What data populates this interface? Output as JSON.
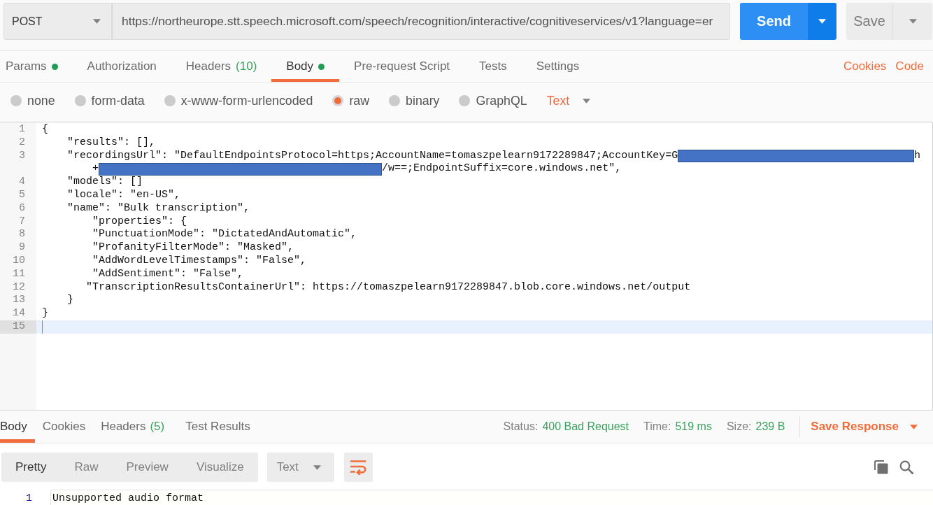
{
  "request_bar": {
    "method": "POST",
    "url": "https://northeurope.stt.speech.microsoft.com/speech/recognition/interactive/cognitiveservices/v1?language=er",
    "send": "Send",
    "save": "Save"
  },
  "request_tabs": [
    {
      "label": "Params",
      "dot": true,
      "selected": false
    },
    {
      "label": "Authorization",
      "dot": false,
      "selected": false
    },
    {
      "label": "Headers",
      "count": "(10)",
      "dot": false,
      "selected": false
    },
    {
      "label": "Body",
      "dot": true,
      "selected": true
    },
    {
      "label": "Pre-request Script",
      "dot": false,
      "selected": false
    },
    {
      "label": "Tests",
      "dot": false,
      "selected": false
    },
    {
      "label": "Settings",
      "dot": false,
      "selected": false
    }
  ],
  "request_links": [
    "Cookies",
    "Code"
  ],
  "body_types": [
    {
      "label": "none",
      "selected": false
    },
    {
      "label": "form-data",
      "selected": false
    },
    {
      "label": "x-www-form-urlencoded",
      "selected": false
    },
    {
      "label": "raw",
      "selected": true
    },
    {
      "label": "binary",
      "selected": false
    },
    {
      "label": "GraphQL",
      "selected": false
    }
  ],
  "body_format": "Text",
  "editor": {
    "lines": [
      {
        "number": "1",
        "kind": "plain",
        "text": "{",
        "current": false
      },
      {
        "number": "2",
        "kind": "plain",
        "text": "    \"results\": [],",
        "current": false
      },
      {
        "number": "3",
        "kind": "wrapped",
        "current": false,
        "rows": [
          {
            "parts": [
              {
                "kind": "text",
                "text": "    \"recordingsUrl\": \"DefaultEndpointsProtocol=https;AccountName=tomaszpelearn9172289847;AccountKey=G"
              },
              {
                "kind": "redacted"
              },
              {
                "kind": "text",
                "text": "h"
              }
            ]
          },
          {
            "parts": [
              {
                "kind": "text",
                "text": "+"
              },
              {
                "kind": "redacted"
              },
              {
                "kind": "text",
                "text": "/w==;EndpointSuffix=core.windows.net\","
              }
            ]
          }
        ]
      },
      {
        "number": "4",
        "kind": "plain",
        "text": "    \"models\": []",
        "current": false
      },
      {
        "number": "5",
        "kind": "plain",
        "text": "    \"locale\": \"en-US\",",
        "current": false
      },
      {
        "number": "6",
        "kind": "plain",
        "text": "    \"name\": \"Bulk transcription\",",
        "current": false
      },
      {
        "number": "7",
        "kind": "plain",
        "text": "        \"properties\": {",
        "current": false
      },
      {
        "number": "8",
        "kind": "plain",
        "text": "        \"PunctuationMode\": \"DictatedAndAutomatic\",",
        "current": false
      },
      {
        "number": "9",
        "kind": "plain",
        "text": "        \"ProfanityFilterMode\": \"Masked\",",
        "current": false
      },
      {
        "number": "10",
        "kind": "plain",
        "text": "        \"AddWordLevelTimestamps\": \"False\",",
        "current": false
      },
      {
        "number": "11",
        "kind": "plain",
        "text": "        \"AddSentiment\": \"False\",",
        "current": false
      },
      {
        "number": "12",
        "kind": "plain",
        "text": "       \"TranscriptionResultsContainerUrl\": https://tomaszpelearn9172289847.blob.core.windows.net/output",
        "current": false
      },
      {
        "number": "13",
        "kind": "plain",
        "text": "    }",
        "current": false
      },
      {
        "number": "14",
        "kind": "plain",
        "text": "}",
        "current": false
      },
      {
        "number": "15",
        "kind": "plain",
        "current": true
      }
    ]
  },
  "response": {
    "tabs": [
      {
        "label": "Body",
        "selected": true
      },
      {
        "label": "Cookies",
        "selected": false
      },
      {
        "label": "Headers",
        "count": "(5)",
        "selected": false
      },
      {
        "label": "Test Results",
        "selected": false
      }
    ],
    "stats": [
      {
        "label": "Status:",
        "value": "400 Bad Request"
      },
      {
        "label": "Time:",
        "value": "519 ms"
      },
      {
        "label": "Size:",
        "value": "239 B"
      }
    ],
    "save": "Save Response",
    "view_modes": [
      {
        "label": "Pretty",
        "selected": true
      },
      {
        "label": "Raw",
        "selected": false
      },
      {
        "label": "Preview",
        "selected": false
      },
      {
        "label": "Visualize",
        "selected": false
      }
    ],
    "format": "Text",
    "wrap_lines": true,
    "lines": [
      {
        "number": "1",
        "text": "Unsupported audio format"
      }
    ]
  }
}
